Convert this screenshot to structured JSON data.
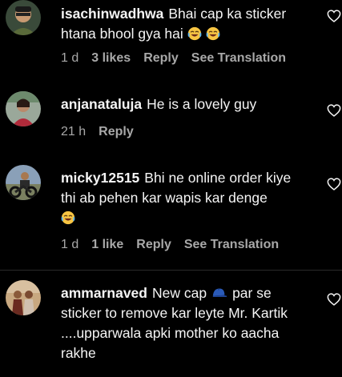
{
  "comments": [
    {
      "username": "isachinwadhwa",
      "text_lines": [
        "Bhai cap ka sticker",
        "htana bhool gya hai"
      ],
      "time": "1 d",
      "likes": "3 likes",
      "reply": "Reply",
      "translation": "See Translation"
    },
    {
      "username": "anjanataluja",
      "text_lines": [
        "He is a lovely guy"
      ],
      "time": "21 h",
      "reply": "Reply"
    },
    {
      "username": "micky12515",
      "text_lines": [
        "Bhi ne online order kiye",
        "thi ab pehen kar wapis kar denge"
      ],
      "time": "1 d",
      "likes": "1 like",
      "reply": "Reply",
      "translation": "See Translation"
    },
    {
      "username": "ammarnaved",
      "text_lines": [
        "New cap",
        "par se",
        "sticker to remove kar leyte Mr. Kartik",
        "....upparwala apki mother ko aacha",
        "rakhe"
      ]
    }
  ],
  "icons": {
    "heart": "heart-outline-icon",
    "laugh": "face-with-tears-of-joy-emoji",
    "cap": "billed-cap-emoji"
  },
  "colors": {
    "background": "#000000",
    "text": "#f5f5f5",
    "meta": "#a8a8a8"
  }
}
